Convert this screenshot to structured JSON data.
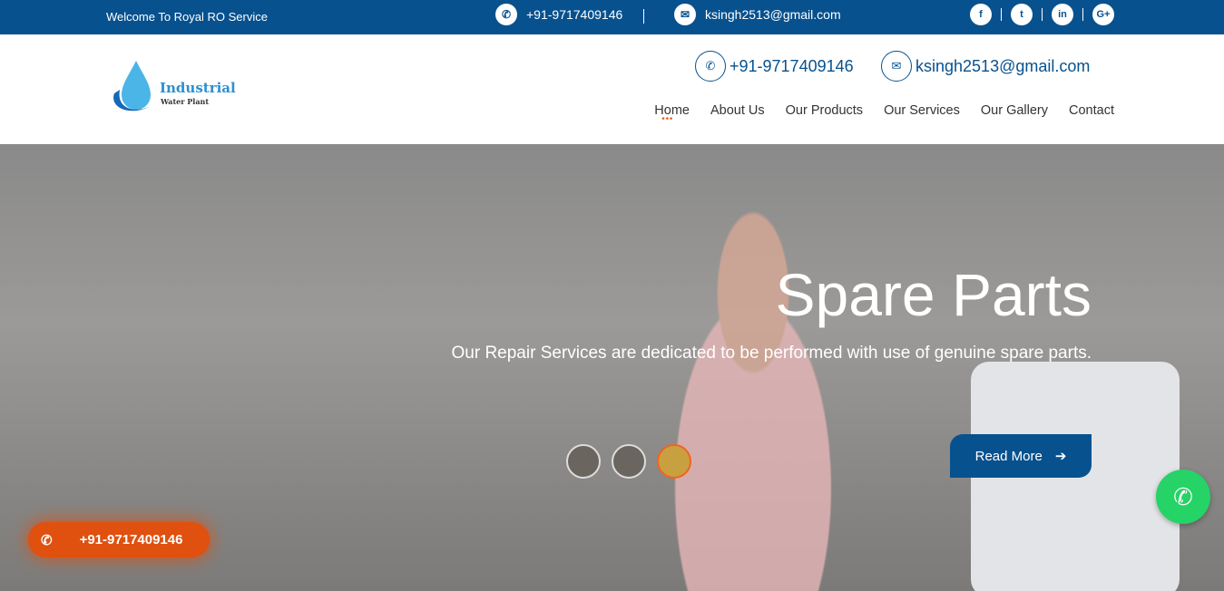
{
  "topbar": {
    "welcome": "Welcome To Royal RO Service",
    "phone": "+91-9717409146",
    "email": "ksingh2513@gmail.com",
    "social": [
      "facebook-icon",
      "twitter-icon",
      "linkedin-icon",
      "google-plus-icon"
    ],
    "social_glyphs": [
      "f",
      "t",
      "in",
      "G+"
    ]
  },
  "logo": {
    "line1": "Industrial",
    "line2": "Water Plant"
  },
  "header": {
    "phone": "+91-9717409146",
    "email": "ksingh2513@gmail.com"
  },
  "nav": [
    "Home",
    "About Us",
    "Our Products",
    "Our Services",
    "Our Gallery",
    "Contact"
  ],
  "hero": {
    "title": "Spare Parts",
    "text": "Our Repair Services are dedicated to be performed with use of genuine spare parts.",
    "button": "Read More",
    "active_slide": 3,
    "slide_count": 3
  },
  "call": {
    "phone": "+91-9717409146"
  },
  "colors": {
    "primary": "#07518e",
    "accent": "#f0641e",
    "whatsapp": "#25d366"
  }
}
